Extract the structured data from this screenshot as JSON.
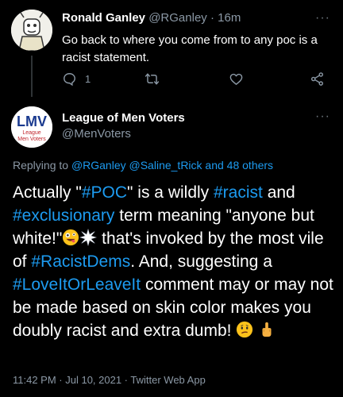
{
  "reply": {
    "name": "Ronald Ganley",
    "handle": "@RGanley",
    "sep": " · ",
    "time": "16m",
    "more": "···",
    "text": "Go back to where you come from to any poc is a racist statement.",
    "reply_count": "1"
  },
  "main": {
    "name": "League of Men Voters",
    "handle": "@MenVoters",
    "more": "···",
    "avatar": {
      "big": "LMV",
      "line1": "League",
      "line2": "Men Voters"
    },
    "replying_prefix": "Replying to ",
    "replying_users": "@RGanley @Saline_tRick",
    "replying_suffix": " and 48 others",
    "text": {
      "t1": "Actually \"",
      "h1": "#POC",
      "t2": "\" is a wildly ",
      "h2": "#racist",
      "t3": " and ",
      "h3": "#exclusionary",
      "t4": " term meaning \"anyone but white!\"",
      "t5": " that's invoked by the most vile of ",
      "h4": "#RacistDems",
      "t6": ".  And, suggesting  a ",
      "h5": "#LoveItOrLeaveIt",
      "t7": " comment  may or may not be made based on skin color makes you doubly racist and extra dumb! "
    },
    "timestamp": "11:42 PM · Jul 10, 2021 · Twitter Web App"
  },
  "icons": [
    "reply-icon",
    "retweet-icon",
    "like-icon",
    "share-icon",
    "more-icon",
    "zany-face-emoji",
    "collision-emoji",
    "confused-face-emoji",
    "middle-finger-emoji"
  ],
  "colors": {
    "background": "#000000",
    "link": "#1d9bf0",
    "secondary": "#8b98a5",
    "avatar_brand": "#1a3a8f"
  }
}
